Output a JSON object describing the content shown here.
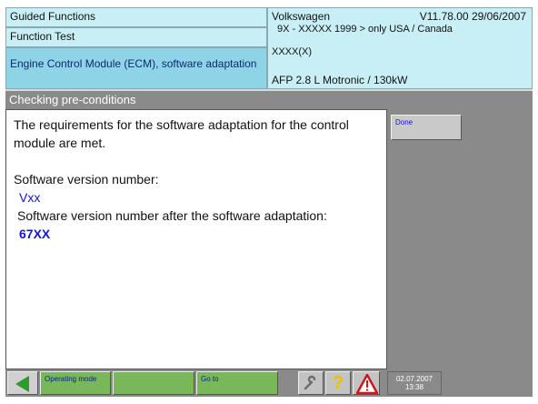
{
  "header": {
    "guided_functions": "Guided Functions",
    "function_test": "Function Test",
    "module": "Engine Control Module (ECM), software adaptation",
    "make": "Volkswagen",
    "version": "V11.78.00 29/06/2007",
    "scope": "9X - XXXXX 1999 > only USA / Canada",
    "code": "XXXX(X)",
    "engine": "AFP 2.8 L Motronic / 130kW"
  },
  "section_title": "Checking pre-conditions",
  "content": {
    "message": "The requirements for the software adaptation for the control module are met.",
    "version_label": "Software version number:",
    "version_value": "Vxx",
    "after_label": "Software version number after the software adaptation:",
    "after_value": "67XX"
  },
  "side": {
    "done_label": "Done"
  },
  "bottom": {
    "operating_mode": "Operating mode",
    "goto": "Go to",
    "help_glyph": "?",
    "date": "02.07.2007",
    "time": "13:38"
  },
  "colors": {
    "header_bg": "#c9eff6",
    "module_bg": "#8ed4e6",
    "panel_gray": "#8a8a8a",
    "green_button": "#7ab65a",
    "value_blue": "#1414d8"
  }
}
